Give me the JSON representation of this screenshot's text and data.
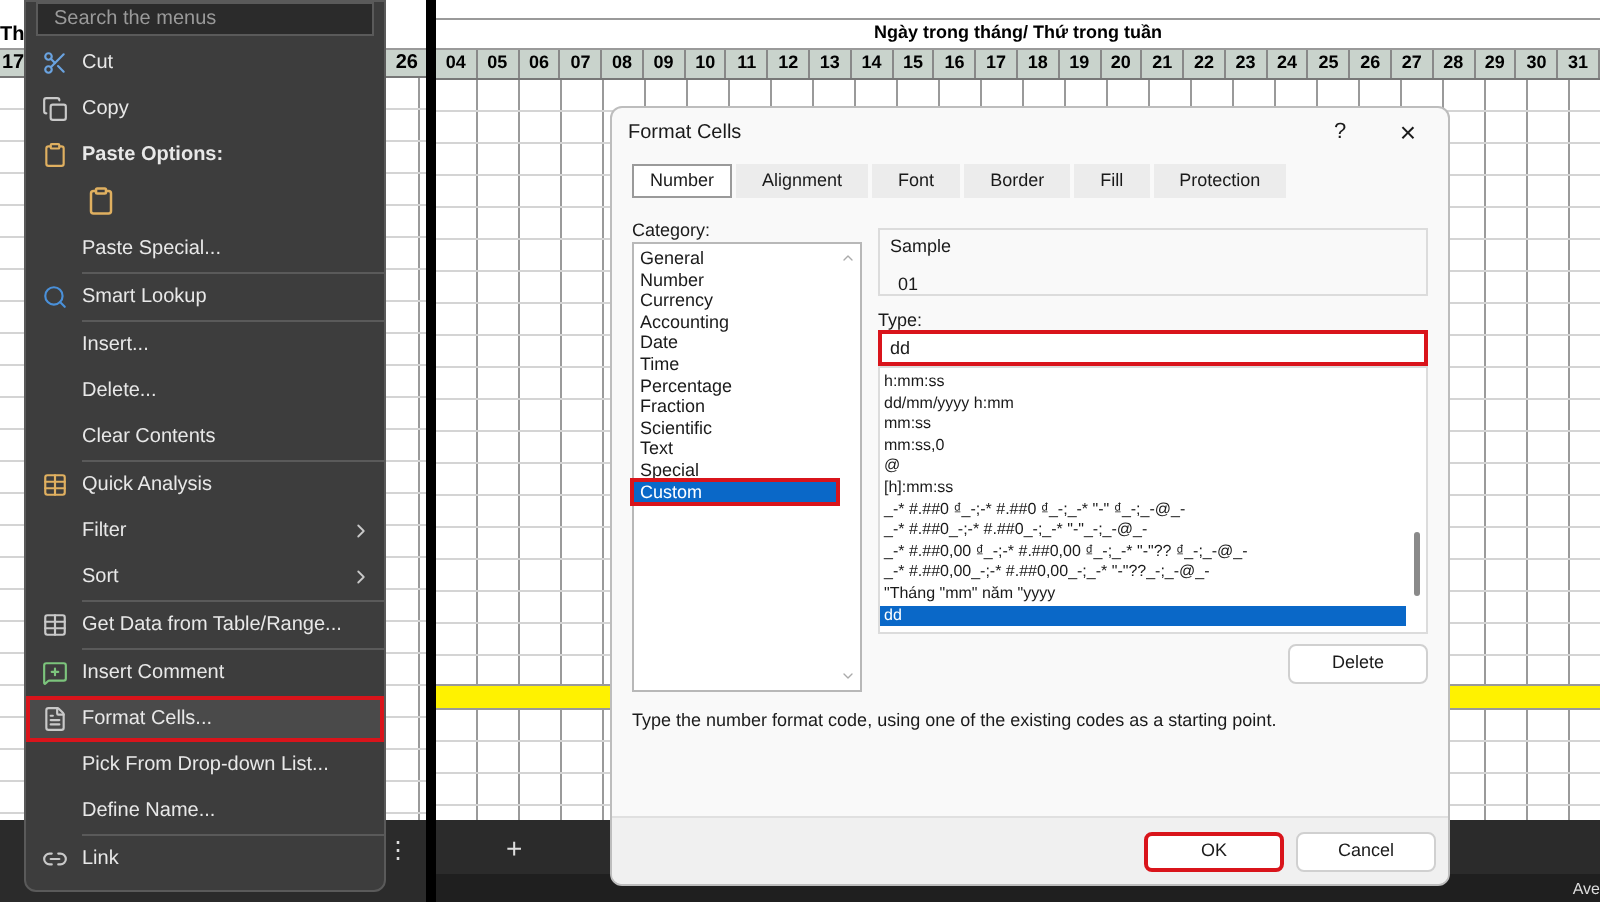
{
  "left_sheet": {
    "header_cell": "Th",
    "day_cells": [
      "17",
      "26"
    ],
    "more_button": "⋮"
  },
  "context_menu": {
    "search": {
      "placeholder": "Search the menus"
    },
    "items": [
      {
        "kind": "item",
        "label": "Cut",
        "submenu": false,
        "highlighted": false
      },
      {
        "kind": "item",
        "label": "Copy",
        "submenu": false,
        "highlighted": false
      },
      {
        "kind": "header",
        "label": "Paste Options:",
        "submenu": false,
        "highlighted": false
      },
      {
        "kind": "paste-option"
      },
      {
        "kind": "item",
        "label": "Paste Special...",
        "submenu": false,
        "highlighted": false
      },
      {
        "kind": "separator"
      },
      {
        "kind": "item",
        "label": "Smart Lookup",
        "submenu": false,
        "highlighted": false
      },
      {
        "kind": "separator"
      },
      {
        "kind": "item",
        "label": "Insert...",
        "submenu": false,
        "highlighted": false
      },
      {
        "kind": "item",
        "label": "Delete...",
        "submenu": false,
        "highlighted": false
      },
      {
        "kind": "item",
        "label": "Clear Contents",
        "submenu": false,
        "highlighted": false
      },
      {
        "kind": "separator"
      },
      {
        "kind": "item",
        "label": "Quick Analysis",
        "submenu": false,
        "highlighted": false
      },
      {
        "kind": "item",
        "label": "Filter",
        "submenu": true,
        "highlighted": false
      },
      {
        "kind": "item",
        "label": "Sort",
        "submenu": true,
        "highlighted": false
      },
      {
        "kind": "separator"
      },
      {
        "kind": "item",
        "label": "Get Data from Table/Range...",
        "submenu": false,
        "highlighted": false
      },
      {
        "kind": "separator"
      },
      {
        "kind": "item",
        "label": "Insert Comment",
        "submenu": false,
        "highlighted": false
      },
      {
        "kind": "item",
        "label": "Format Cells...",
        "submenu": false,
        "highlighted": true
      },
      {
        "kind": "item",
        "label": "Pick From Drop-down List...",
        "submenu": false,
        "highlighted": false
      },
      {
        "kind": "item",
        "label": "Define Name...",
        "submenu": false,
        "highlighted": false
      },
      {
        "kind": "separator"
      },
      {
        "kind": "item",
        "label": "Link",
        "submenu": false,
        "highlighted": false
      }
    ]
  },
  "right_sheet": {
    "title": "Ngày trong tháng/ Thứ trong tuần",
    "days": [
      "04",
      "05",
      "06",
      "07",
      "08",
      "09",
      "10",
      "11",
      "12",
      "13",
      "14",
      "15",
      "16",
      "17",
      "18",
      "19",
      "20",
      "21",
      "22",
      "23",
      "24",
      "25",
      "26",
      "27",
      "28",
      "29",
      "30",
      "31"
    ],
    "add_sheet_button": "+",
    "status_text": "Ave"
  },
  "dialog": {
    "title": "Format Cells",
    "help_button": "?",
    "close_button": "×",
    "tabs": [
      {
        "label": "Number",
        "selected": true
      },
      {
        "label": "Alignment",
        "selected": false
      },
      {
        "label": "Font",
        "selected": false
      },
      {
        "label": "Border",
        "selected": false
      },
      {
        "label": "Fill",
        "selected": false
      },
      {
        "label": "Protection",
        "selected": false
      }
    ],
    "category_label": "Category:",
    "categories": [
      {
        "label": "General",
        "selected": false,
        "highlighted": false
      },
      {
        "label": "Number",
        "selected": false,
        "highlighted": false
      },
      {
        "label": "Currency",
        "selected": false,
        "highlighted": false
      },
      {
        "label": "Accounting",
        "selected": false,
        "highlighted": false
      },
      {
        "label": "Date",
        "selected": false,
        "highlighted": false
      },
      {
        "label": "Time",
        "selected": false,
        "highlighted": false
      },
      {
        "label": "Percentage",
        "selected": false,
        "highlighted": false
      },
      {
        "label": "Fraction",
        "selected": false,
        "highlighted": false
      },
      {
        "label": "Scientific",
        "selected": false,
        "highlighted": false
      },
      {
        "label": "Text",
        "selected": false,
        "highlighted": false
      },
      {
        "label": "Special",
        "selected": false,
        "highlighted": false
      },
      {
        "label": "Custom",
        "selected": true,
        "highlighted": true
      }
    ],
    "sample_label": "Sample",
    "sample_value": "01",
    "type_label": "Type:",
    "type_value": "dd",
    "type_highlighted": true,
    "formats": [
      {
        "label": "h:mm:ss",
        "selected": false
      },
      {
        "label": "dd/mm/yyyy h:mm",
        "selected": false
      },
      {
        "label": "mm:ss",
        "selected": false
      },
      {
        "label": "mm:ss,0",
        "selected": false
      },
      {
        "label": "@",
        "selected": false
      },
      {
        "label": "[h]:mm:ss",
        "selected": false
      },
      {
        "label": "_-* #.##0 ₫_-;-* #.##0 ₫_-;_-* \"-\" ₫_-;_-@_-",
        "selected": false
      },
      {
        "label": "_-* #.##0_-;-* #.##0_-;_-* \"-\"_-;_-@_-",
        "selected": false
      },
      {
        "label": "_-* #.##0,00 ₫_-;-* #.##0,00 ₫_-;_-* \"-\"?? ₫_-;_-@_-",
        "selected": false
      },
      {
        "label": "_-* #.##0,00_-;-* #.##0,00_-;_-* \"-\"??_-;_-@_-",
        "selected": false
      },
      {
        "label": "\"Tháng \"mm\" năm \"yyyy",
        "selected": false
      },
      {
        "label": "dd",
        "selected": true
      }
    ],
    "delete_button": "Delete",
    "hint": "Type the number format code, using one of the existing codes as a starting point.",
    "buttons": [
      {
        "label": "OK",
        "highlighted": true
      },
      {
        "label": "Cancel",
        "highlighted": false
      }
    ]
  }
}
